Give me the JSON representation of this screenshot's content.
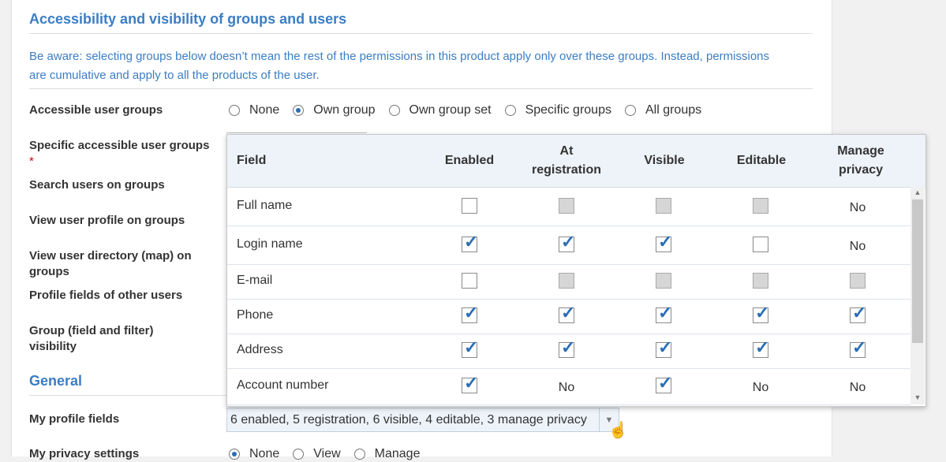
{
  "section1": {
    "title": "Accessibility and visibility of groups and users",
    "notice": "Be aware: selecting groups below doesn’t mean the rest of the permissions in this product apply only over these groups. Instead, permissions are cumulative and apply to all the products of the user."
  },
  "labels": {
    "accessible_groups": "Accessible user groups",
    "specific_groups": "Specific accessible user groups",
    "required_marker": "*",
    "search_users": "Search users on groups",
    "view_profile": "View user profile on groups",
    "view_directory": "View user directory (map) on groups",
    "profile_fields_others": "Profile fields of other users",
    "group_visibility": "Group (field and filter) visibility",
    "my_profile_fields": "My profile fields",
    "my_privacy": "My privacy settings"
  },
  "accessible_groups_options": [
    "None",
    "Own group",
    "Own group set",
    "Specific groups",
    "All groups"
  ],
  "accessible_groups_selected": "Own group",
  "section2": {
    "title": "General"
  },
  "popup": {
    "headers": {
      "field": "Field",
      "enabled": "Enabled",
      "at_registration_1": "At",
      "at_registration_2": "registration",
      "visible": "Visible",
      "editable": "Editable",
      "manage_privacy_1": "Manage",
      "manage_privacy_2": "privacy"
    },
    "rows": [
      {
        "field": "Full name",
        "enabled": "unchecked",
        "registration": "disabled",
        "visible": "disabled",
        "editable": "disabled",
        "privacy": "No"
      },
      {
        "field": "Login name",
        "enabled": "checked",
        "registration": "checked",
        "visible": "checked",
        "editable": "unchecked",
        "privacy": "No"
      },
      {
        "field": "E-mail",
        "enabled": "unchecked",
        "registration": "disabled",
        "visible": "disabled",
        "editable": "disabled",
        "privacy": "disabled"
      },
      {
        "field": "Phone",
        "enabled": "checked",
        "registration": "checked",
        "visible": "checked",
        "editable": "checked",
        "privacy": "checked"
      },
      {
        "field": "Address",
        "enabled": "checked",
        "registration": "checked",
        "visible": "checked",
        "editable": "checked",
        "privacy": "checked"
      },
      {
        "field": "Account number",
        "enabled": "checked",
        "registration": "No",
        "visible": "checked",
        "editable": "No",
        "privacy": "No"
      }
    ]
  },
  "summary": "6 enabled, 5 registration, 6 visible, 4 editable, 3 manage privacy",
  "privacy_options": [
    "None",
    "View",
    "Manage"
  ],
  "privacy_selected": "None",
  "colors": {
    "accent": "#3b7dc4",
    "check": "#2b6db3",
    "header_bg": "#eef3fa"
  }
}
